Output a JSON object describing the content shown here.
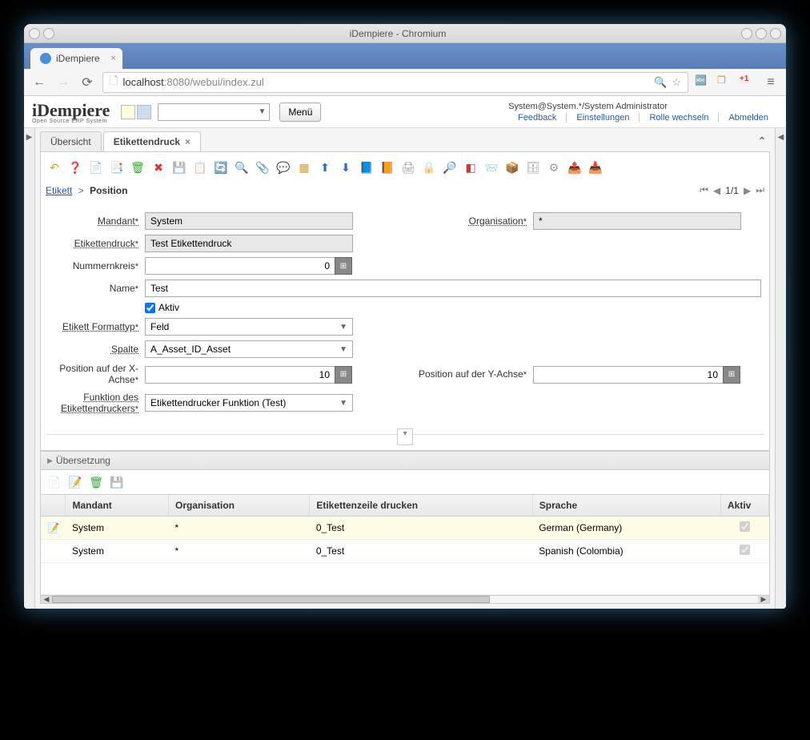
{
  "window": {
    "title": "iDempiere - Chromium"
  },
  "browser": {
    "tab_title": "iDempiere",
    "url_host": "localhost",
    "url_port": ":8080",
    "url_path": "/webui/index.zul"
  },
  "header": {
    "logo": "iDempiere",
    "logo_sub": "Open Source ERP System",
    "menu_button": "Menü",
    "user_context": "System@System.*/System Administrator",
    "links": {
      "feedback": "Feedback",
      "settings": "Einstellungen",
      "changerole": "Rolle wechseln",
      "logout": "Abmelden"
    }
  },
  "tabs": {
    "overview": "Übersicht",
    "active": "Etikettendruck"
  },
  "breadcrumb": {
    "root": "Etikett",
    "sep": ">",
    "current": "Position"
  },
  "pager": {
    "pos": "1/1"
  },
  "form": {
    "labels": {
      "mandant": "Mandant",
      "organisation": "Organisation",
      "etikettendruck": "Etikettendruck",
      "nummernkreis": "Nummernkreis",
      "name": "Name",
      "aktiv": "Aktiv",
      "formattyp": "Etikett Formattyp",
      "spalte": "Spalte",
      "posx": "Position auf der X-Achse",
      "posy": "Position auf der Y-Achse",
      "funktion": "Funktion des Etikettendruckers"
    },
    "values": {
      "mandant": "System",
      "organisation": "*",
      "etikettendruck": "Test Etikettendruck",
      "nummernkreis": "0",
      "name": "Test",
      "aktiv": true,
      "formattyp": "Feld",
      "spalte": "A_Asset_ID_Asset",
      "posx": "10",
      "posy": "10",
      "funktion": "Etikettendrucker Funktion (Test)"
    }
  },
  "subpanel": {
    "title": "Übersetzung",
    "columns": {
      "mandant": "Mandant",
      "organisation": "Organisation",
      "zeile": "Etikettenzeile drucken",
      "sprache": "Sprache",
      "aktiv": "Aktiv"
    },
    "rows": [
      {
        "mandant": "System",
        "organisation": "*",
        "zeile": "0_Test",
        "sprache": "German (Germany)",
        "aktiv": true
      },
      {
        "mandant": "System",
        "organisation": "*",
        "zeile": "0_Test",
        "sprache": "Spanish (Colombia)",
        "aktiv": true
      }
    ]
  }
}
